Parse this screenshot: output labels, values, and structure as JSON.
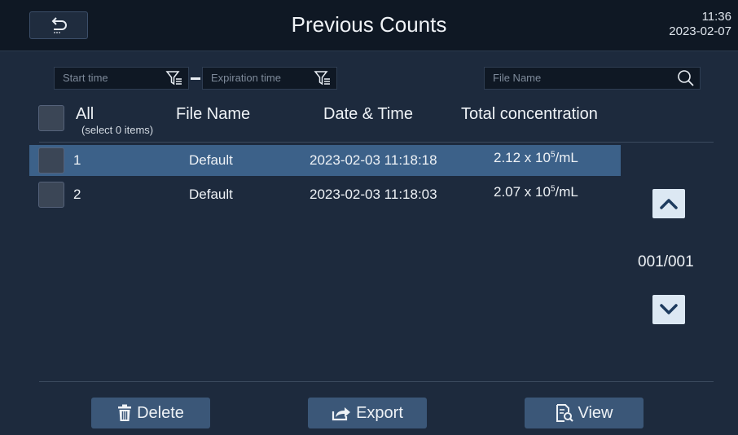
{
  "header": {
    "title": "Previous Counts",
    "time": "11:36",
    "date": "2023-02-07"
  },
  "filters": {
    "start_time_placeholder": "Start time",
    "expiration_time_placeholder": "Expiration time",
    "file_name_placeholder": "File Name"
  },
  "table": {
    "select_all_label": "All",
    "select_count_text": "(select 0 items)",
    "columns": [
      "File Name",
      "Date & Time",
      "Total concentration"
    ],
    "rows": [
      {
        "index": "1",
        "file_name": "Default",
        "datetime": "2023-02-03 11:18:18",
        "conc_value": "2.12 x 10",
        "conc_exp": "5",
        "conc_unit": "/mL",
        "selected": true
      },
      {
        "index": "2",
        "file_name": "Default",
        "datetime": "2023-02-03 11:18:03",
        "conc_value": "2.07 x 10",
        "conc_exp": "5",
        "conc_unit": "/mL",
        "selected": false
      }
    ]
  },
  "pager": {
    "page_text": "001/001"
  },
  "actions": {
    "delete_label": "Delete",
    "export_label": "Export",
    "view_label": "View"
  },
  "colors": {
    "background": "#1d2a3d",
    "title_bar": "#0f1824",
    "selected_row": "#3c6189",
    "action_button": "#3b5778"
  }
}
